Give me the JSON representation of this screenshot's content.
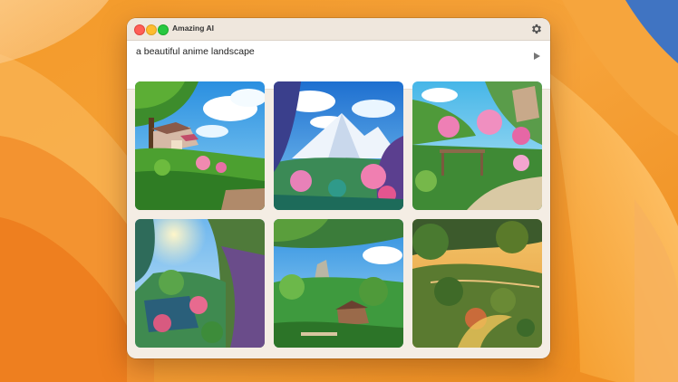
{
  "window": {
    "title": "Amazing AI"
  },
  "prompt": {
    "text": "a beautiful anime landscape"
  },
  "icons": {
    "settings": "gear-icon",
    "run": "play-icon"
  },
  "colors": {
    "window_bg": "#f4ede4",
    "desktop": "#f49a28"
  }
}
